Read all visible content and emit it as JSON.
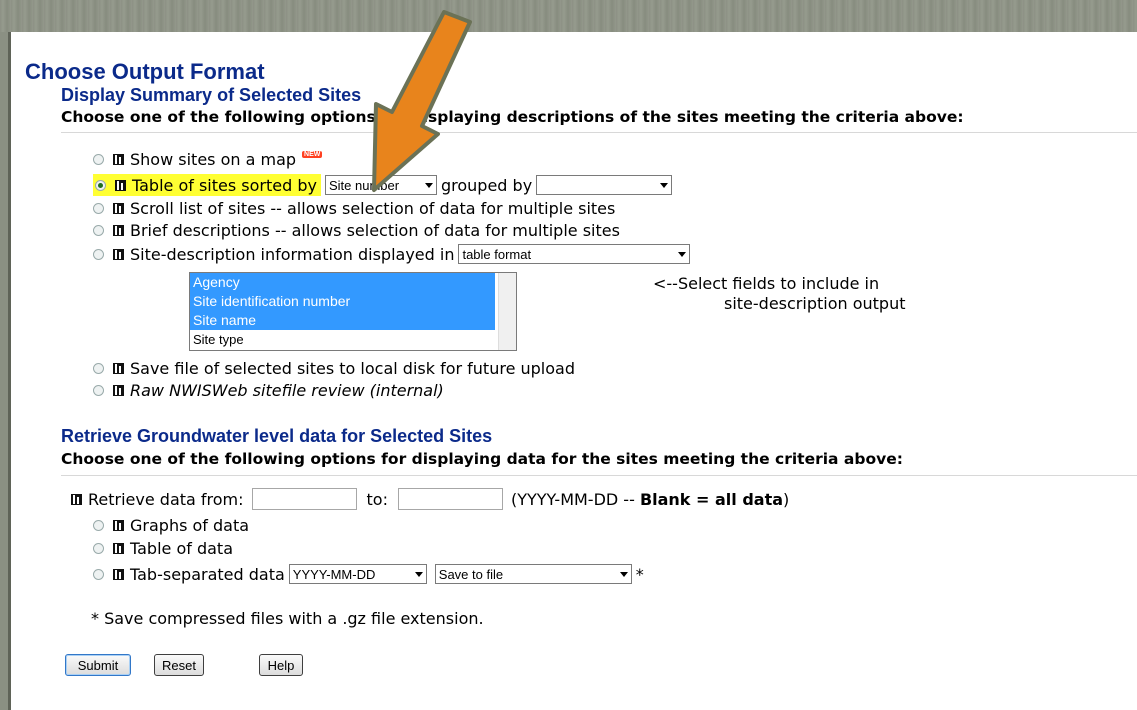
{
  "page": {
    "title": "Choose Output Format",
    "summary_heading": "Display Summary of Selected Sites",
    "summary_instruction": "Choose one of the following options for displaying descriptions of the sites meeting the criteria above:",
    "options": [
      {
        "label": "Show sites on a map",
        "badge": "NEW"
      },
      {
        "label": "Table of sites sorted by",
        "sort_value": "Site number",
        "group_label": "grouped by",
        "group_value": ""
      },
      {
        "label": "Scroll list of sites -- allows selection of data for multiple sites"
      },
      {
        "label": "Brief descriptions -- allows selection of data for multiple sites"
      },
      {
        "label": "Site-description information displayed in",
        "format_value": "table format"
      },
      {
        "label": "Save file of selected sites to local disk for future upload"
      },
      {
        "label": "Raw NWISWeb sitefile review (internal)"
      }
    ],
    "fields_list": [
      "Agency",
      "Site identification number",
      "Site name",
      "Site type"
    ],
    "fields_note_1": "<--Select fields to include in",
    "fields_note_2": "site-description output",
    "retrieve_heading": "Retrieve Groundwater level data for Selected Sites",
    "retrieve_instruction": "Choose one of the following options for displaying data for the sites meeting the criteria above:",
    "retrieve_from_label": "Retrieve data from:",
    "retrieve_to_label": "to:",
    "retrieve_format_prefix": "(YYYY-MM-DD -- ",
    "retrieve_format_blank": "Blank = all data",
    "retrieve_format_suffix": ")",
    "data_options": [
      {
        "label": "Graphs of data"
      },
      {
        "label": "Table of data"
      },
      {
        "label": "Tab-separated data",
        "date_format": "YYYY-MM-DD",
        "save_option": "Save to file",
        "asterisk": "*"
      }
    ],
    "footnote": "* Save compressed files with a .gz file extension.",
    "buttons": {
      "submit": "Submit",
      "reset": "Reset",
      "help": "Help"
    }
  },
  "colors": {
    "heading": "#0b2a8a",
    "highlight": "#ffff33",
    "selection": "#3399ff",
    "arrow": "#e8841c"
  }
}
